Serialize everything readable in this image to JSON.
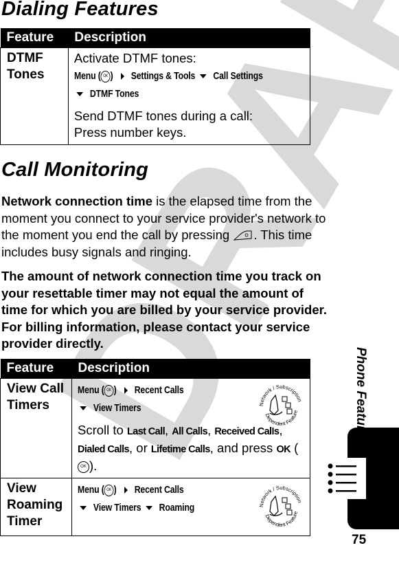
{
  "watermark": "DRAFT",
  "sections": {
    "dialing": {
      "title": "Dialing Features",
      "table": {
        "headers": [
          "Feature",
          "Description"
        ],
        "rows": [
          {
            "feature": "DTMF Tones",
            "intro": "Activate DTMF tones:",
            "path": {
              "menu": "Menu",
              "ok_icon": "OK",
              "step1": "Settings & Tools",
              "step2": "Call Settings",
              "step3": "DTMF Tones"
            },
            "extra_line1": "Send DTMF tones during a call:",
            "extra_line2": "Press number keys."
          }
        ]
      }
    },
    "monitoring": {
      "title": "Call Monitoring",
      "para1": {
        "term": "Network connection time",
        "text1": " is the elapsed time from the moment you connect to your service provider's network to the moment you end the call by pressing ",
        "text2": ". This time includes busy signals and ringing."
      },
      "para2": "The amount of network connection time you track on your resettable timer may not equal the amount of time for which you are billed by your service provider. For billing information, please contact your service provider directly.",
      "table": {
        "headers": [
          "Feature",
          "Description"
        ],
        "rows": [
          {
            "feature": "View Call Timers",
            "path": {
              "menu": "Menu",
              "ok_icon": "OK",
              "step1": "Recent Calls",
              "step2": "View Timers"
            },
            "scroll_prefix": "Scroll to ",
            "options": [
              "Last Call",
              "All Calls",
              "Received Calls",
              "Dialed Calls",
              "Lifetime Calls"
            ],
            "scroll_or": "or",
            "scroll_suffix": ", and press ",
            "ok_label": "OK",
            "badge": "Network / Subscription Dependent Feature"
          },
          {
            "feature": "View Roaming Timer",
            "path": {
              "menu": "Menu",
              "ok_icon": "OK",
              "step1": "Recent Calls",
              "step2": "View Timers",
              "step3": "Roaming"
            },
            "badge": "Network / Subscription Dependent Feature"
          }
        ]
      }
    }
  },
  "sidebar": {
    "section_title": "Phone Features"
  },
  "footer": {
    "page_number": "75"
  }
}
